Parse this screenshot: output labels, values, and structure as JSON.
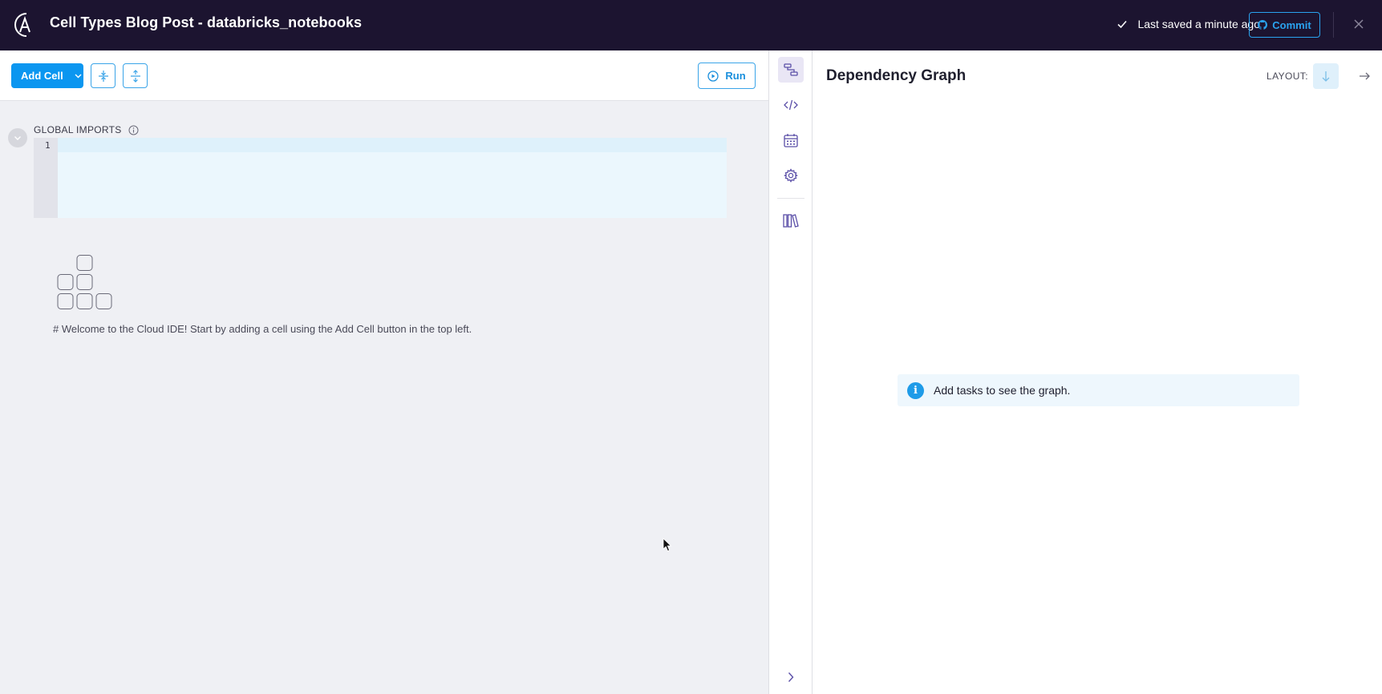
{
  "header": {
    "title": "Cell Types Blog Post - databricks_notebooks",
    "saved_status": "Last saved a minute ago",
    "commit_label": "Commit",
    "icons": [
      "astronomer-logo",
      "check-icon",
      "github-icon",
      "close-icon"
    ]
  },
  "toolbar": {
    "add_cell_label": "Add Cell",
    "run_label": "Run",
    "icons": [
      "chevron-down-icon",
      "collapse-all-icon",
      "expand-all-icon",
      "play-circle-icon"
    ]
  },
  "global_imports": {
    "label": "GLOBAL IMPORTS",
    "line_number": "1",
    "code": ""
  },
  "empty_state": {
    "message": "# Welcome to the Cloud IDE! Start by adding a cell using the Add Cell button in the top left."
  },
  "rail": {
    "items": [
      "graph-icon",
      "code-icon",
      "calendar-icon",
      "gear-icon",
      "library-icon"
    ],
    "active": "graph-icon",
    "bottom": "chevron-right-icon"
  },
  "graph_panel": {
    "title": "Dependency Graph",
    "layout_label": "LAYOUT:",
    "info_icon": "i",
    "info_message": "Add tasks to see the graph."
  },
  "colors": {
    "header_bg": "#1c1430",
    "accent": "#0b96f0",
    "editor_bg": "#ebf7fd",
    "pane_bg": "#eff0f4"
  }
}
